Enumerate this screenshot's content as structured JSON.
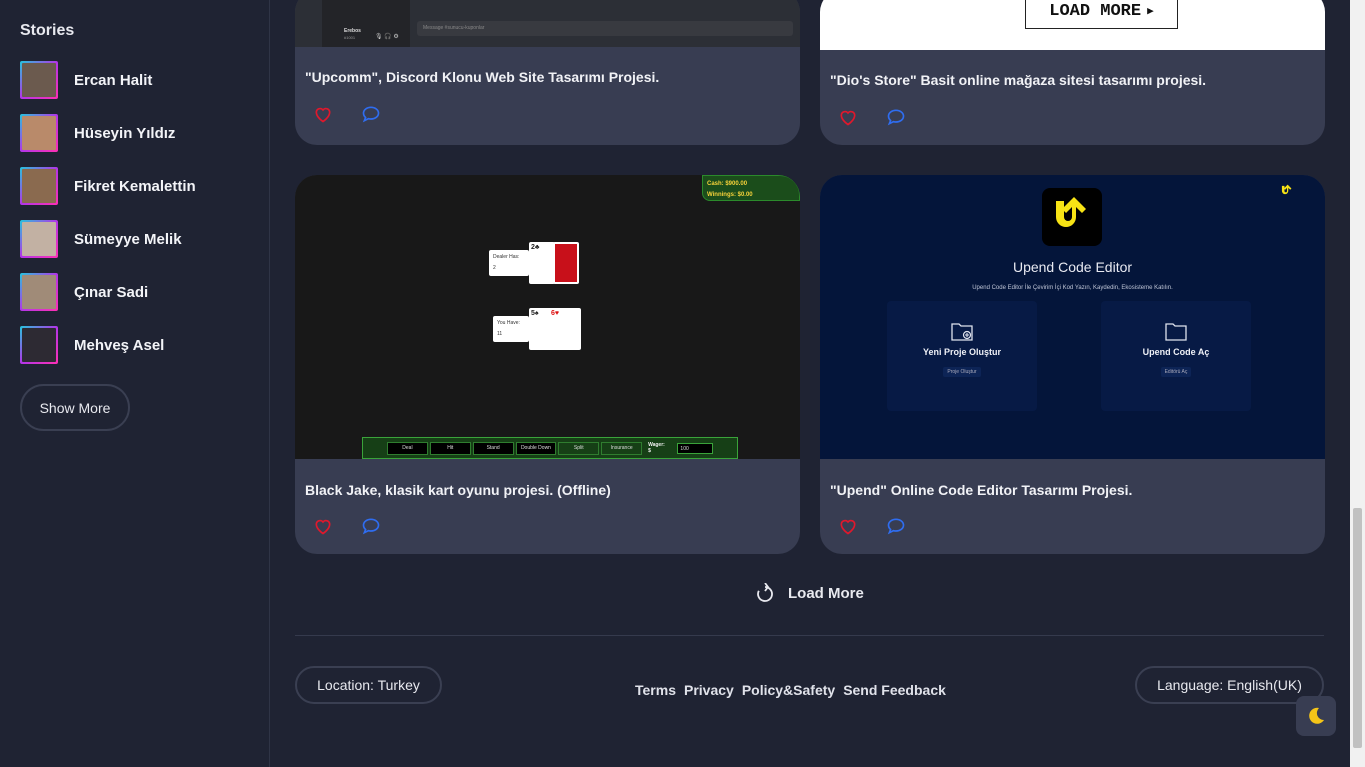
{
  "sidebar": {
    "title": "Stories",
    "stories": [
      {
        "name": "Ercan Halit",
        "color": "#6b5a4e"
      },
      {
        "name": "Hüseyin Yıldız",
        "color": "#b98a6a"
      },
      {
        "name": "Fikret Kemalettin",
        "color": "#8a6a4f"
      },
      {
        "name": "Sümeyye Melik",
        "color": "#c2b1a3"
      },
      {
        "name": "Çınar Sadi",
        "color": "#a08b78"
      },
      {
        "name": "Mehveş Asel",
        "color": "#2d2a33"
      }
    ],
    "show_more": "Show More"
  },
  "cards": [
    {
      "title": "\"Upcomm\", Discord Klonu Web Site Tasarımı Projesi.",
      "preview": {
        "user": "Erebos",
        "tag": "#1001",
        "message_placeholder": "Message #sunucu-kuponlar"
      }
    },
    {
      "title": "\"Dio's Store\" Basit online mağaza sitesi tasarımı projesi.",
      "preview": {
        "button": "LOAD MORE"
      }
    },
    {
      "title": "Black Jake, klasik kart oyunu projesi. (Offline)",
      "preview": {
        "cash": "Cash: $900.00",
        "winnings": "Winnings: $0.00",
        "dealer_label": "Dealer Has:",
        "dealer_value": "2",
        "dealer_card": "2♣",
        "you_label": "You Have:",
        "you_value": "11",
        "you_cards": [
          "5♠",
          "6♥"
        ],
        "buttons": [
          "Deal",
          "Hit",
          "Stand",
          "Double Down",
          "Split",
          "Insurance"
        ],
        "wager_label": "Wager: $",
        "wager_value": "100"
      }
    },
    {
      "title": "\"Upend\" Online Code Editor Tasarımı Projesi.",
      "preview": {
        "heading": "Upend Code Editor",
        "subheading": "Upend Code Editor İle Çevirim İçi Kod Yazın, Kaydedin, Ekosisteme Katılın.",
        "tiles": [
          {
            "title": "Yeni Proje Oluştur",
            "button": "Proje Oluştur"
          },
          {
            "title": "Upend Code Aç",
            "button": "Editörü Aç"
          }
        ]
      }
    }
  ],
  "load_more": "Load More",
  "footer": {
    "location": "Location: Turkey",
    "links": [
      "Terms",
      "Privacy",
      "Policy&Safety",
      "Send Feedback"
    ],
    "language": "Language: English(UK)"
  },
  "colors": {
    "heart": "#e0182c",
    "comment": "#2f6df0",
    "moon": "#f5c518",
    "upend_yellow": "#f7e315"
  }
}
